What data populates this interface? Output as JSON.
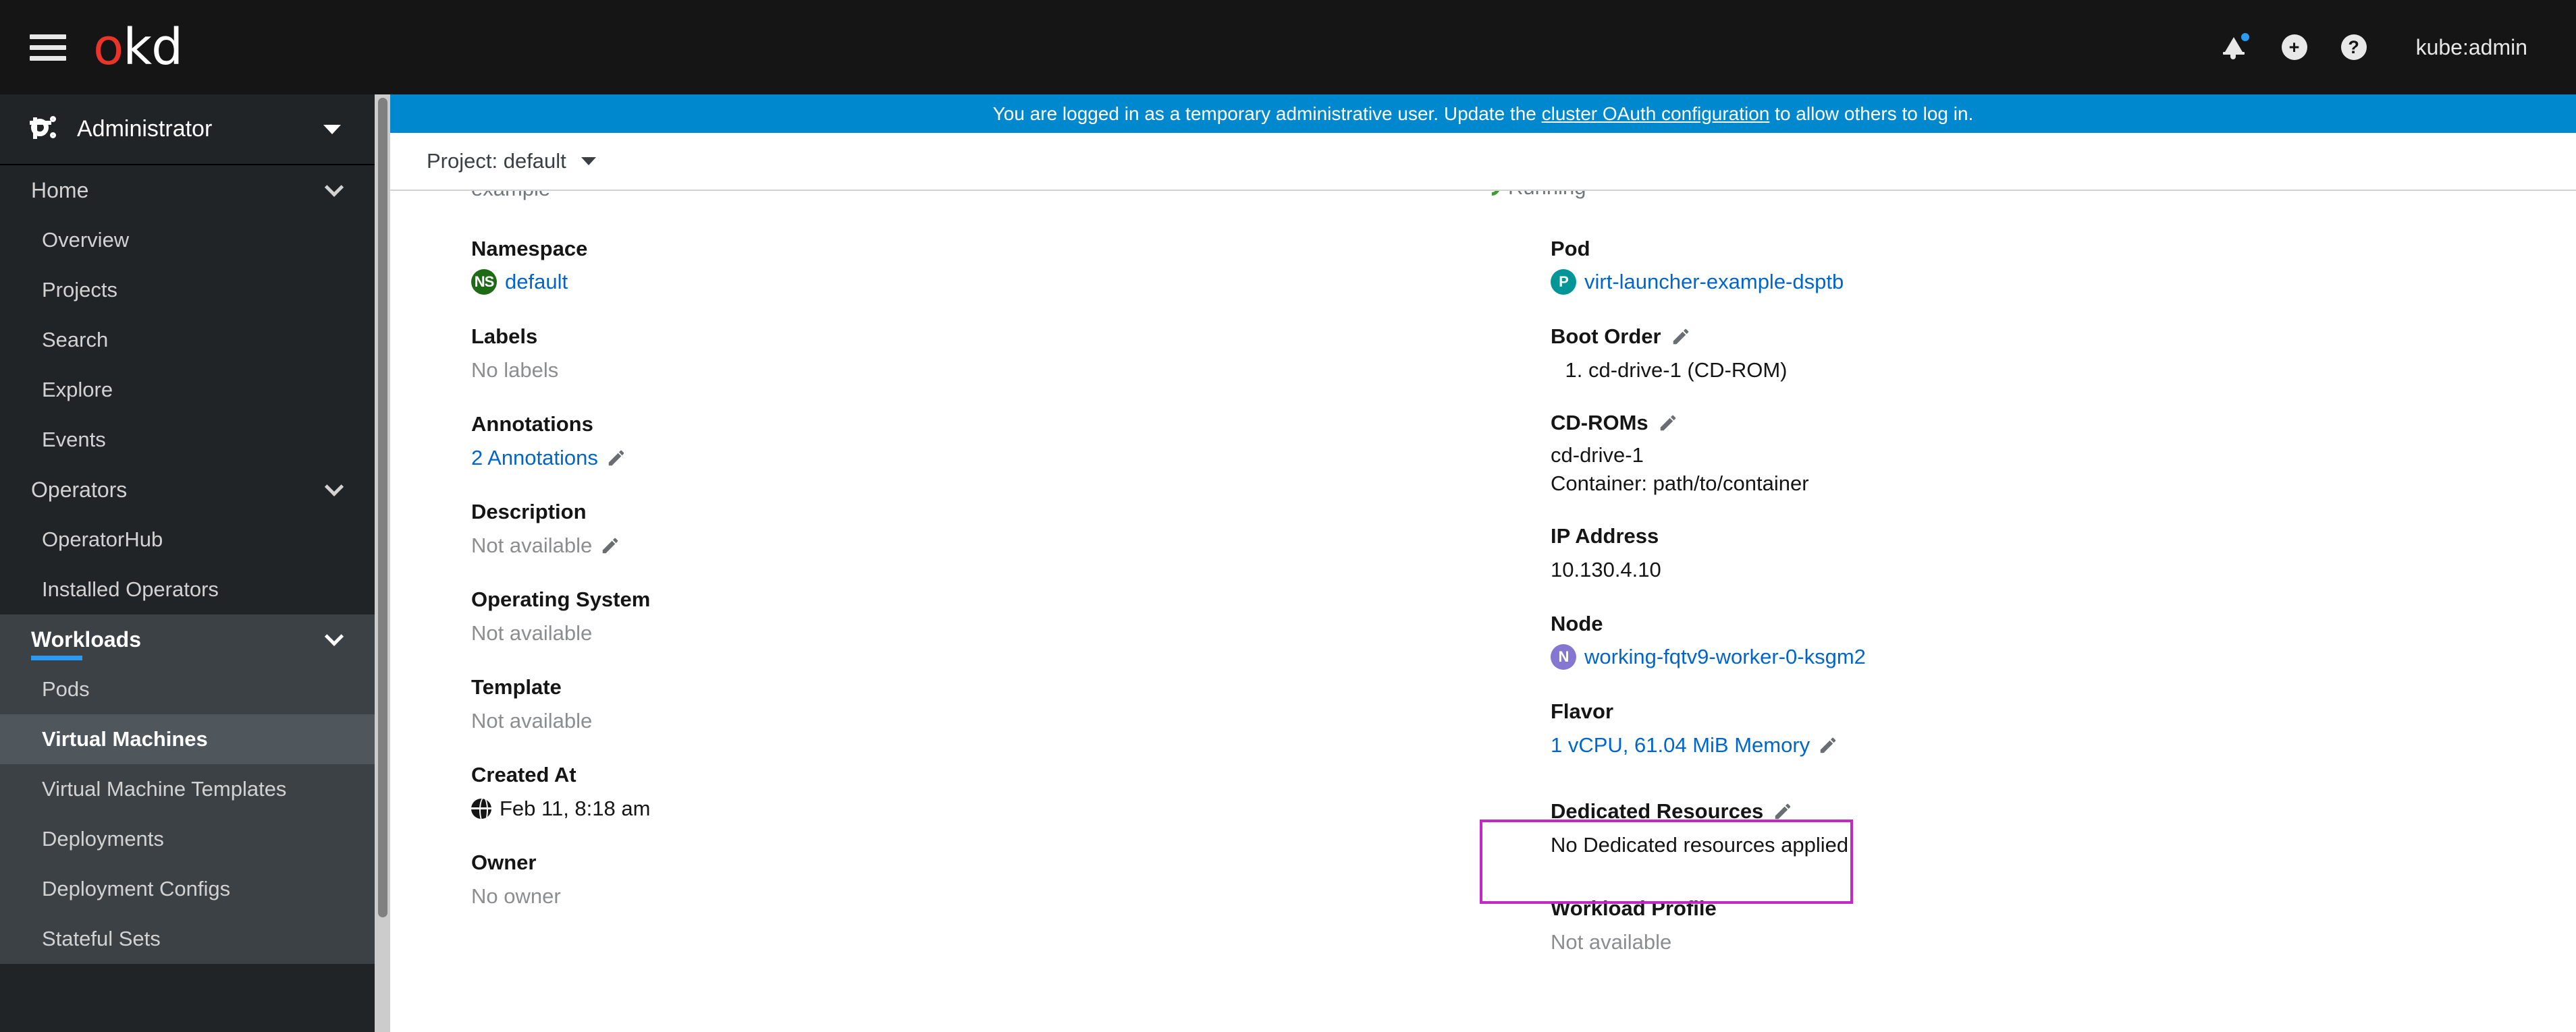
{
  "masthead": {
    "brand_o": "o",
    "brand_kd": "kd",
    "hamburger_name": "hamburger-menu",
    "notification_icon": "bell-icon",
    "plus_icon": "plus-circle-icon",
    "help_icon": "question-circle-icon",
    "username": "kube:admin",
    "background": "#151515",
    "brand_accent": "#e8342a"
  },
  "banner": {
    "text_before": "You are logged in as a temporary administrative user. Update the ",
    "link": "cluster OAuth configuration",
    "text_after": " to allow others to log in.",
    "background": "#0088ce"
  },
  "sidebar": {
    "perspective": "Administrator",
    "groups": [
      {
        "label": "Home",
        "items": [
          "Overview",
          "Projects",
          "Search",
          "Explore",
          "Events"
        ]
      },
      {
        "label": "Operators",
        "items": [
          "OperatorHub",
          "Installed Operators"
        ]
      },
      {
        "label": "Workloads",
        "items": [
          "Pods",
          "Virtual Machines",
          "Virtual Machine Templates",
          "Deployments",
          "Deployment Configs",
          "Stateful Sets"
        ]
      }
    ],
    "active_item": "Virtual Machines",
    "active_group": "Workloads",
    "accent": "#2b9af3"
  },
  "project_bar": {
    "label": "Project: default"
  },
  "content": {
    "cut_off_left": "example",
    "cut_off_right": "Running",
    "left_column": [
      {
        "label": "Namespace",
        "value": "default",
        "badge": "NS",
        "link": true
      },
      {
        "label": "Labels",
        "value": "No labels",
        "muted": true
      },
      {
        "label": "Annotations",
        "value": "2 Annotations",
        "link": true,
        "pencil": true
      },
      {
        "label": "Description",
        "value": "Not available",
        "muted": true,
        "pencil": true
      },
      {
        "label": "Operating System",
        "value": "Not available",
        "muted": true
      },
      {
        "label": "Template",
        "value": "Not available",
        "muted": true
      },
      {
        "label": "Created At",
        "value": "Feb 11, 8:18 am",
        "globe": true
      },
      {
        "label": "Owner",
        "value": "No owner",
        "muted": true
      }
    ],
    "right_column": {
      "pod": {
        "label": "Pod",
        "value": "virt-launcher-example-dsptb",
        "badge": "P"
      },
      "boot_order": {
        "label": "Boot Order",
        "items": [
          "cd-drive-1 (CD-ROM)"
        ]
      },
      "cdroms": {
        "label": "CD-ROMs",
        "name": "cd-drive-1",
        "container": "Container: path/to/container"
      },
      "ip_address": {
        "label": "IP Address",
        "value": "10.130.4.10"
      },
      "node": {
        "label": "Node",
        "value": "working-fqtv9-worker-0-ksgm2",
        "badge": "N"
      },
      "flavor": {
        "label": "Flavor",
        "value": "1 vCPU, 61.04 MiB Memory"
      },
      "dedicated_resources": {
        "label": "Dedicated Resources",
        "value": "No Dedicated resources applied",
        "highlight_color": "#c428c4"
      },
      "workload_profile": {
        "label": "Workload Profile",
        "value": "Not available"
      }
    }
  }
}
